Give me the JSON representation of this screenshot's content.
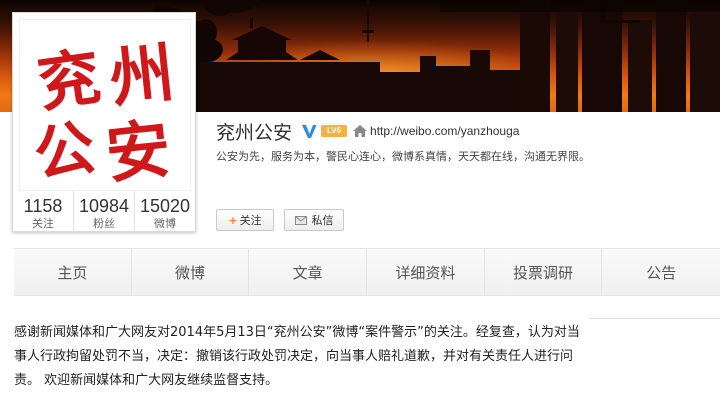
{
  "profile": {
    "name": "兖州公安",
    "verified": true,
    "level_badge": "LV6",
    "homepage_url": "http://weibo.com/yanzhouga",
    "description": "公安为先，服务为本，警民心连心，微博系真情，天天都在线，沟通无界限。",
    "avatar_text": [
      "兖",
      "州",
      "公",
      "安"
    ],
    "stats": [
      {
        "value": "1158",
        "label": "关注"
      },
      {
        "value": "10984",
        "label": "粉丝"
      },
      {
        "value": "15020",
        "label": "微博"
      }
    ],
    "actions": {
      "follow_symbol": "+",
      "follow_label": "关注",
      "message_label": "私信"
    }
  },
  "tabs": [
    "主页",
    "微博",
    "文章",
    "详细资料",
    "投票调研",
    "公告"
  ],
  "notice": "感谢新闻媒体和广大网友对2014年5月13日“兖州公安”微博“案件警示”的关注。经复查，认为对当事人行政拘留处罚不当，决定：撤销该行政处罚决定，向当事人赔礼道歉，并对有关责任人进行问责。 欢迎新闻媒体和广大网友继续监督支持。",
  "colors": {
    "accent_orange": "#ff8140",
    "avatar_red": "#d0181b",
    "verified_blue": "#2d8be3",
    "level_gold": "#f2b43d"
  },
  "icons": {
    "verified": "verified-v-icon",
    "homepage": "home-icon",
    "message": "mail-icon"
  }
}
